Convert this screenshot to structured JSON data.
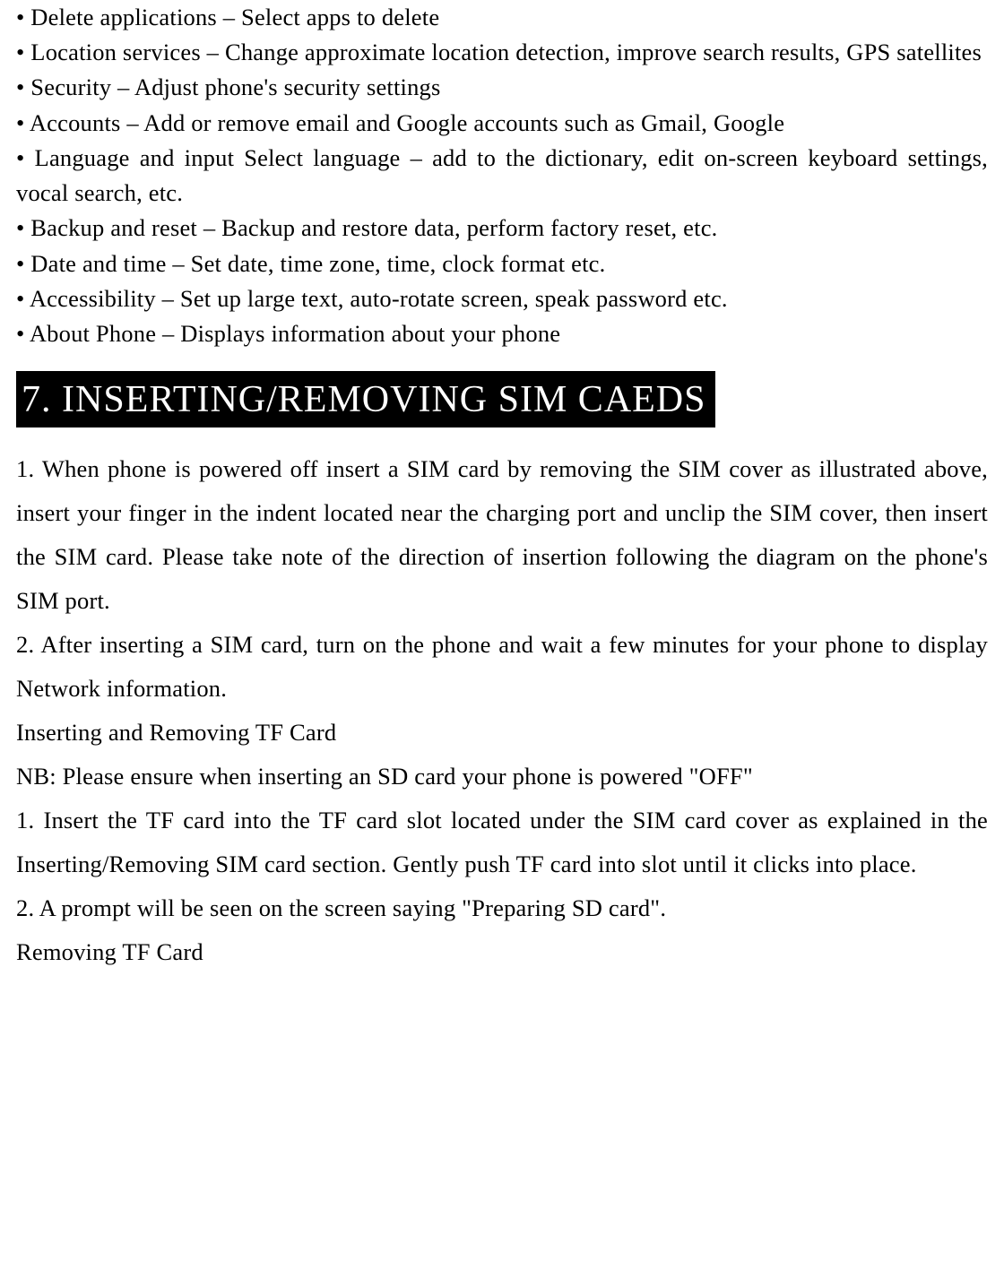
{
  "bullets": {
    "b0": "• Delete applications – Select apps to delete",
    "b1": "• Location services – Change approximate location detection, improve search results, GPS satellites",
    "b2": "• Security – Adjust phone's security settings",
    "b3": "• Accounts – Add or remove email and Google accounts such as Gmail, Google",
    "b4": "• Language and input Select language – add to the dictionary, edit on-screen keyboard settings, vocal search, etc.",
    "b5": "• Backup and reset – Backup and restore data, perform factory reset, etc.",
    "b6": "• Date and time – Set date, time zone, time, clock format etc.",
    "b7": "• Accessibility – Set up large text, auto-rotate screen, speak password etc.",
    "b8": "• About Phone – Displays information about your phone"
  },
  "heading": "7. INSERTING/REMOVING SIM CAEDS",
  "steps": {
    "s0": "1.  When phone is powered off insert a SIM card by removing the SIM cover as illustrated above, insert your finger in the indent located near the charging port and unclip the SIM cover, then insert the SIM card. Please take note of the direction of insertion following the diagram on the phone's SIM port.",
    "s1": "2.  After inserting a SIM card, turn on the phone and wait a few minutes for your phone to display Network information.",
    "s2": "Inserting and Removing TF Card",
    "s3": "NB: Please ensure when inserting an SD card your phone is powered \"OFF\"",
    "s4": "1. Insert the TF card into the TF card slot located under the SIM card cover as explained in the Inserting/Removing SIM card section. Gently push TF card into slot until it clicks into place.",
    "s5": "2. A prompt will be seen on the screen saying \"Preparing SD card\".",
    "s6": "Removing TF Card"
  }
}
